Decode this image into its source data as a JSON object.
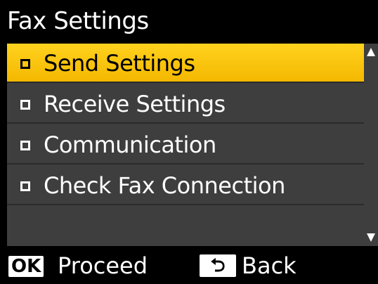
{
  "header": {
    "title": "Fax Settings"
  },
  "menu": {
    "items": [
      {
        "label": "Send Settings",
        "selected": true
      },
      {
        "label": "Receive Settings",
        "selected": false
      },
      {
        "label": "Communication",
        "selected": false
      },
      {
        "label": "Check Fax Connection",
        "selected": false
      }
    ]
  },
  "footer": {
    "ok_key": "OK",
    "ok_action": "Proceed",
    "back_action": "Back",
    "back_icon": "back-arrow-icon"
  },
  "colors": {
    "highlight": "#f4b800",
    "panel": "#3e3e3e",
    "background": "#000000"
  }
}
